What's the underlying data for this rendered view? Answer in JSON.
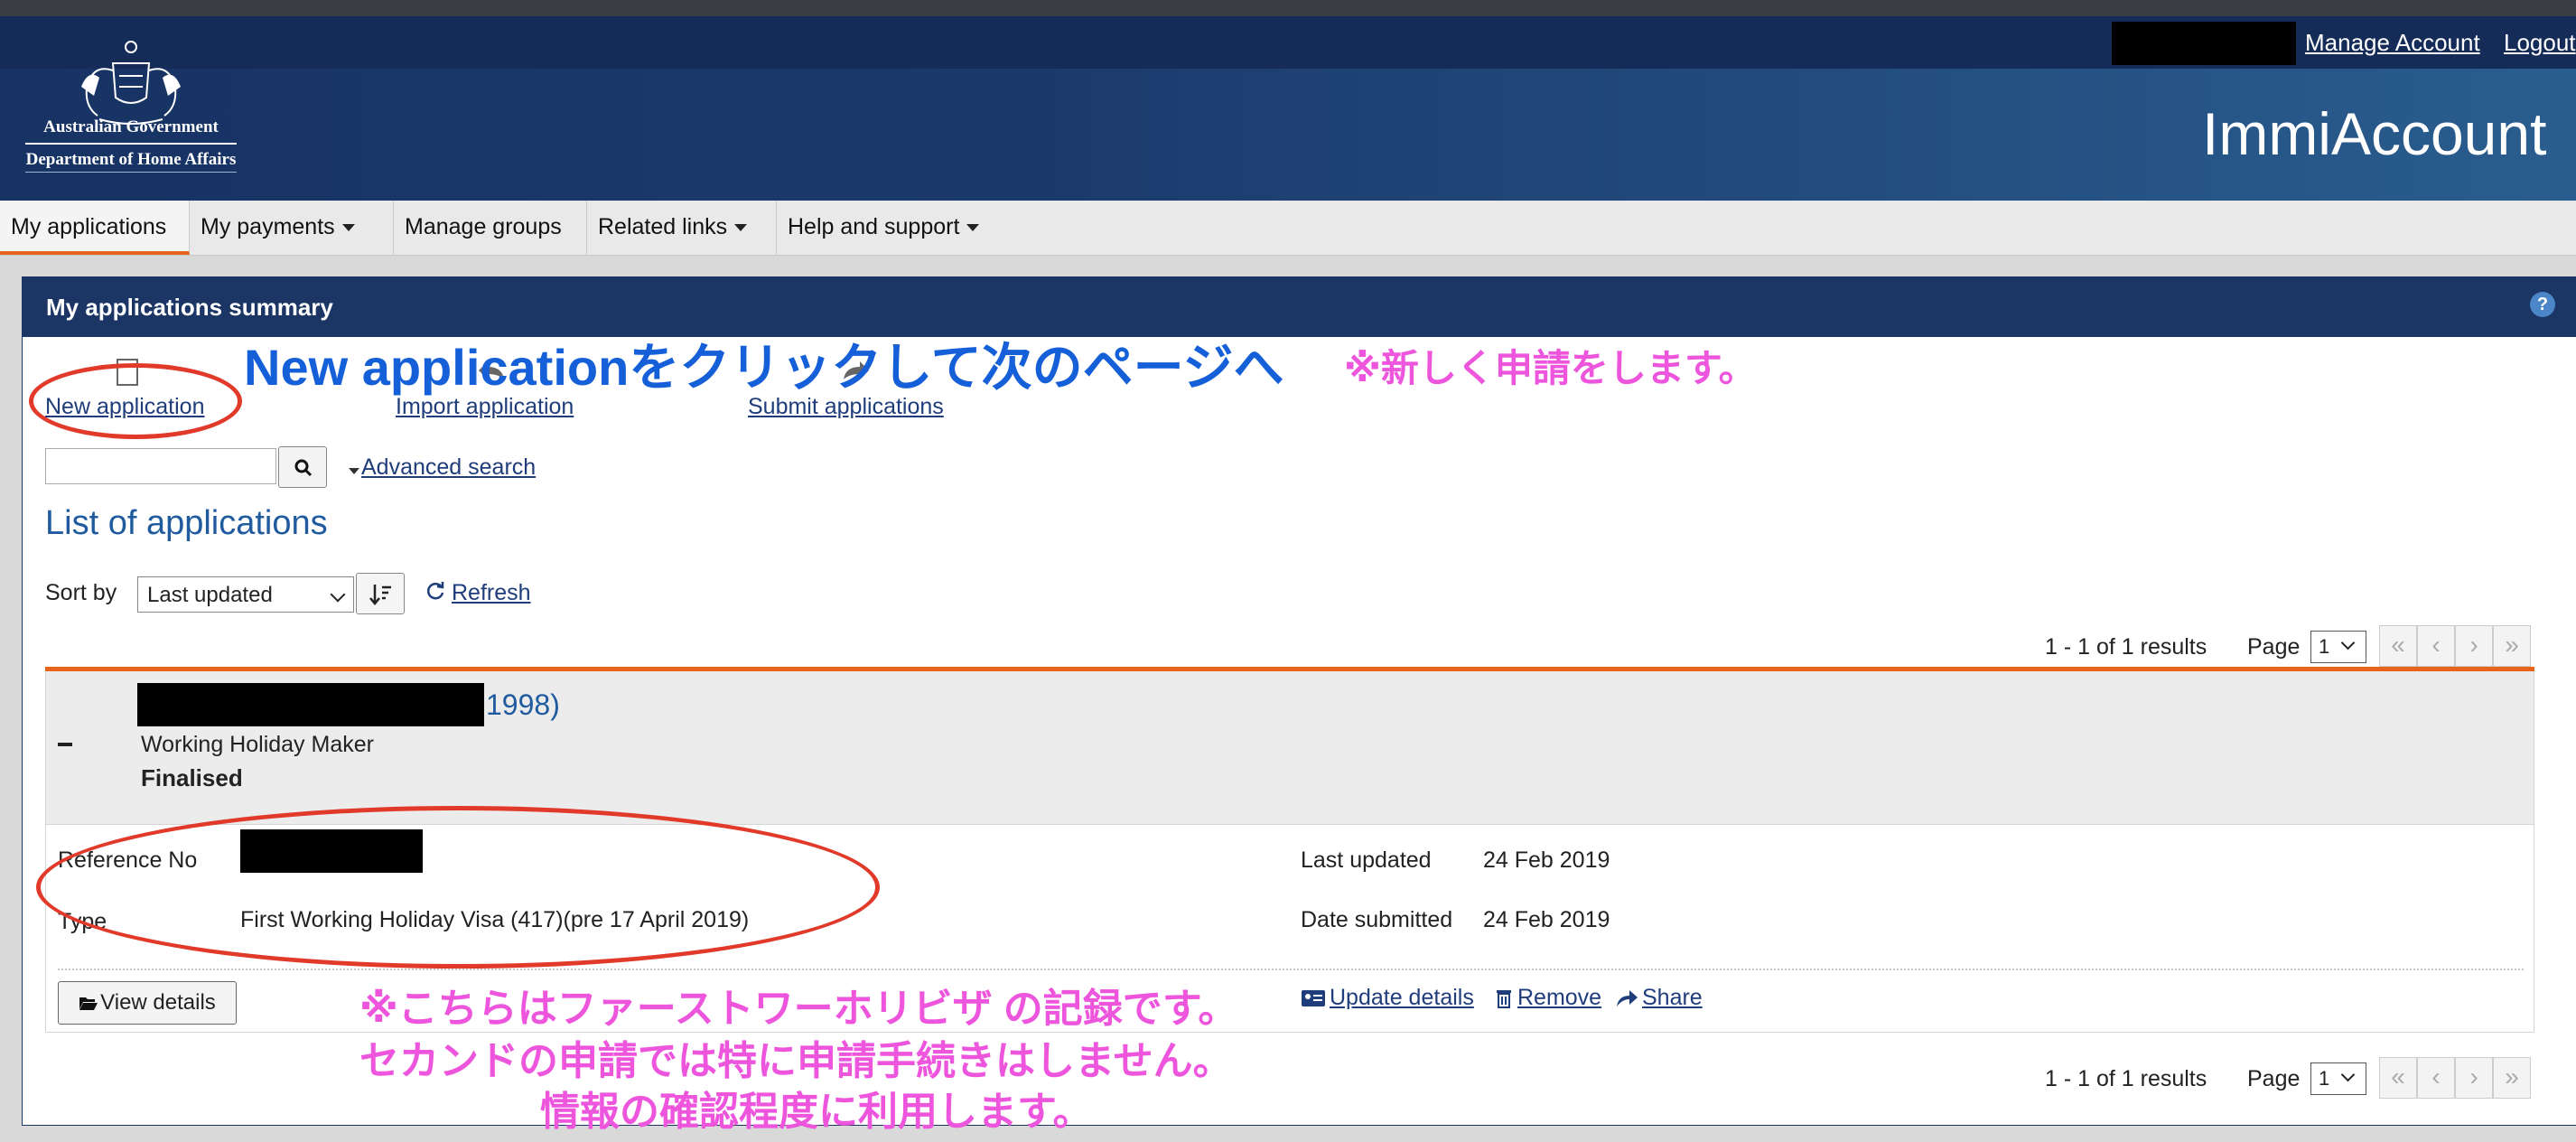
{
  "header": {
    "gov_line1": "Australian Government",
    "gov_line2": "Department of Home Affairs",
    "manage_account": "Manage Account",
    "logout": "Logout",
    "app_title": "ImmiAccount"
  },
  "nav": [
    {
      "label": "My applications",
      "dropdown": false,
      "active": true
    },
    {
      "label": "My payments",
      "dropdown": true
    },
    {
      "label": "Manage groups",
      "dropdown": false
    },
    {
      "label": "Related links",
      "dropdown": true
    },
    {
      "label": "Help and support",
      "dropdown": true
    }
  ],
  "panel": {
    "title": "My applications summary",
    "help": "?"
  },
  "actions": {
    "new_application": "New application",
    "import_application": "Import application",
    "submit_applications": "Submit applications"
  },
  "annotations": {
    "new_app_instruction": "New applicationをクリックして次のページへ",
    "new_app_note": "※新しく申請をします。",
    "record_line1": "※こちらはファーストワーホリビザ の記録です。",
    "record_line2": "セカンドの申請では特に申請手続きはしません。",
    "record_line3": "情報の確認程度に利用します。"
  },
  "search": {
    "placeholder": "",
    "advanced": "Advanced search"
  },
  "list": {
    "title": "List of applications",
    "sort_label": "Sort by",
    "sort_value": "Last updated",
    "refresh": "Refresh",
    "results": "1 - 1 of 1 results",
    "page_label": "Page",
    "page_value": "1"
  },
  "application": {
    "name_suffix": "1998)",
    "stream": "Working Holiday Maker",
    "status": "Finalised",
    "ref_label": "Reference No",
    "type_label": "Type",
    "type_value": "First Working Holiday Visa (417)(pre 17 April 2019)",
    "last_updated_label": "Last updated",
    "last_updated_value": "24 Feb 2019",
    "date_submitted_label": "Date submitted",
    "date_submitted_value": "24 Feb 2019",
    "view_details": "View details",
    "update_details": "Update details",
    "remove": "Remove",
    "share": "Share"
  },
  "colors": {
    "header_dark": "#142c57",
    "accent_orange": "#e8641b",
    "panel_header": "#1b3564",
    "annotation_blue": "#1560d8",
    "annotation_pink": "#ee55dd",
    "annotation_red": "#e23a2a"
  }
}
